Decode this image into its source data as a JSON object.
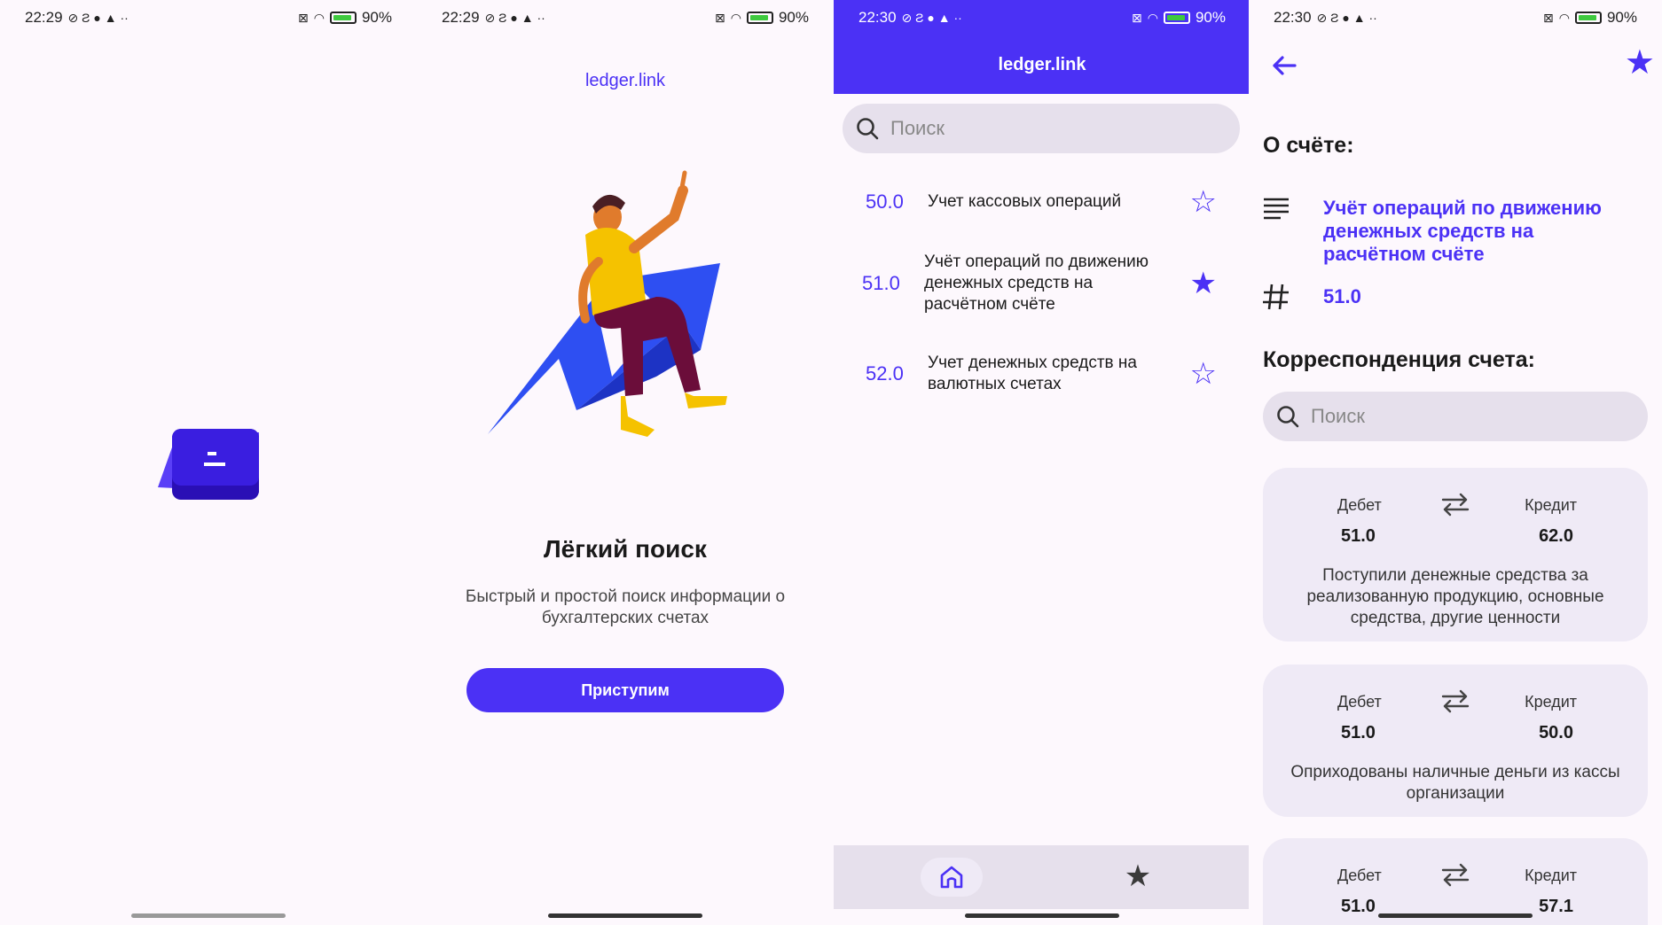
{
  "colors": {
    "accent": "#4b31f5",
    "surface": "#efeaf6",
    "search_bg": "#e6e0ec"
  },
  "screens": [
    {
      "status": {
        "time": "22:29",
        "battery": "90%"
      }
    },
    {
      "status": {
        "time": "22:29",
        "battery": "90%"
      },
      "brand": "ledger.link",
      "title": "Лёгкий поиск",
      "description": "Быстрый и простой поиск информации о бухгалтерских счетах",
      "cta": "Приступим"
    },
    {
      "status": {
        "time": "22:30",
        "battery": "90%"
      },
      "title": "ledger.link",
      "search_placeholder": "Поиск",
      "accounts": [
        {
          "code": "50.0",
          "name": "Учет кассовых операций",
          "favorite": false
        },
        {
          "code": "51.0",
          "name": "Учёт операций по движению денежных средств на расчётном счёте",
          "favorite": true
        },
        {
          "code": "52.0",
          "name": "Учет денежных средств на валютных счетах",
          "favorite": false
        }
      ],
      "nav": [
        {
          "icon": "home-icon",
          "active": true
        },
        {
          "icon": "star-icon",
          "active": false
        }
      ]
    },
    {
      "status": {
        "time": "22:30",
        "battery": "90%"
      },
      "about_heading": "О счёте:",
      "account_name": "Учёт операций по движению денежных средств на расчётном счёте",
      "account_code": "51.0",
      "correspondence_heading": "Корреспонденция счета:",
      "search_placeholder": "Поиск",
      "debit_label": "Дебет",
      "credit_label": "Кредит",
      "entries": [
        {
          "debit": "51.0",
          "credit": "62.0",
          "description": "Поступили денежные средства за реализованную продукцию, основные средства, другие ценности"
        },
        {
          "debit": "51.0",
          "credit": "50.0",
          "description": "Оприходованы наличные деньги из кассы организации"
        },
        {
          "debit": "51.0",
          "credit": "57.1",
          "description": ""
        }
      ]
    }
  ]
}
